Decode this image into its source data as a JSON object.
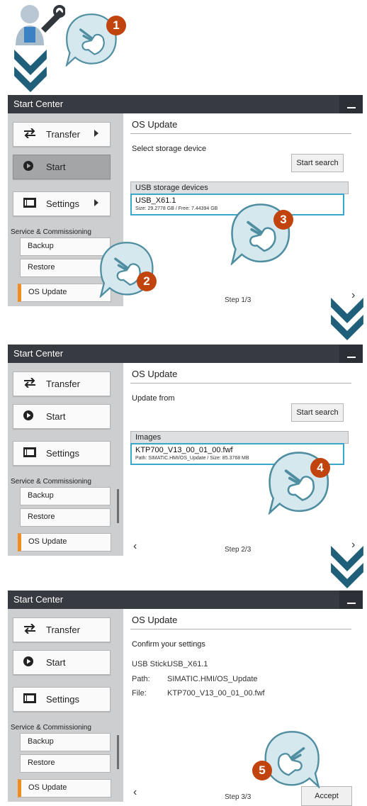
{
  "colors": {
    "titlebar": "#373a41",
    "accent_orange": "#f28c1e",
    "selection_blue": "#3aa6c9",
    "chevron_teal": "#1f5f7a",
    "badge_red": "#c1440e"
  },
  "badges": [
    "1",
    "2",
    "3",
    "4",
    "5"
  ],
  "panels": [
    {
      "titlebar": "Start Center",
      "menu": {
        "transfer": "Transfer",
        "start": "Start",
        "settings": "Settings"
      },
      "section_label": "Service & Commissioning",
      "service_items": [
        "Backup",
        "Restore",
        "OS Update"
      ],
      "main_title": "OS Update",
      "subtitle": "Select storage device",
      "search_button": "Start search",
      "list_header": "USB storage devices",
      "list_item_name": "USB_X61.1",
      "list_item_detail": "Size: 29.2778 GB / Free: 7.44394 GB",
      "step": "Step 1/3",
      "next": "›"
    },
    {
      "titlebar": "Start Center",
      "menu": {
        "transfer": "Transfer",
        "start": "Start",
        "settings": "Settings"
      },
      "section_label": "Service & Commissioning",
      "service_items": [
        "Backup",
        "Restore",
        "OS Update"
      ],
      "main_title": "OS Update",
      "subtitle": "Update from",
      "search_button": "Start search",
      "list_header": "Images",
      "list_item_name": "KTP700_V13_00_01_00.fwf",
      "list_item_detail": "Path: SIMATIC.HMI/OS_Update / Size: 85.3768 MB",
      "step": "Step 2/3",
      "prev": "‹",
      "next": "›"
    },
    {
      "titlebar": "Start Center",
      "menu": {
        "transfer": "Transfer",
        "start": "Start",
        "settings": "Settings"
      },
      "section_label": "Service & Commissioning",
      "service_items": [
        "Backup",
        "Restore",
        "OS Update"
      ],
      "main_title": "OS Update",
      "subtitle": "Confirm your settings",
      "settings": [
        {
          "key": "USB Stick:",
          "value": "USB_X61.1"
        },
        {
          "key": "Path:",
          "value": "SIMATIC.HMI/OS_Update"
        },
        {
          "key": "File:",
          "value": "KTP700_V13_00_01_00.fwf"
        }
      ],
      "step": "Step 3/3",
      "prev": "‹",
      "accept_button": "Accept"
    }
  ]
}
